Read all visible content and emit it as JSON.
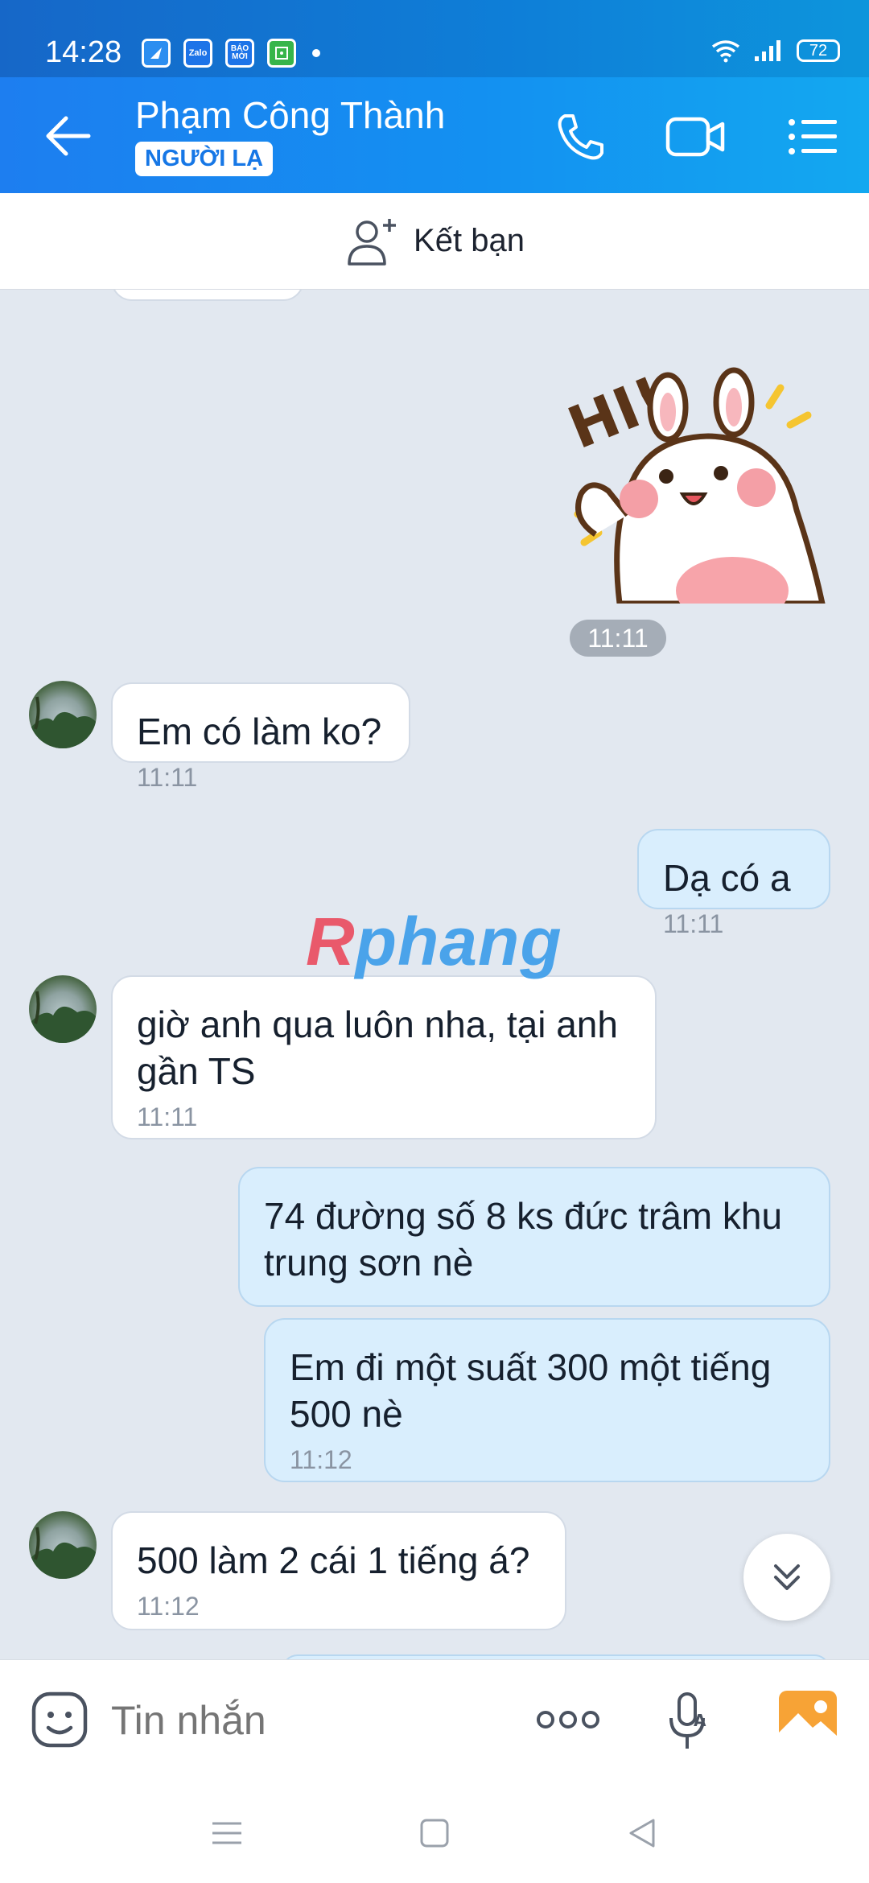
{
  "status": {
    "time": "14:28",
    "battery": "72",
    "app_icons": [
      "Zalo",
      "BÁO MỚI"
    ]
  },
  "header": {
    "contact_name": "Phạm Công Thành",
    "badge": "NGƯỜI LẠ"
  },
  "friend_bar": {
    "label": "Kết bạn"
  },
  "sticker_time": "11:11",
  "messages": [
    {
      "dir": "in",
      "text": "Em có làm ko?",
      "time": "11:11"
    },
    {
      "dir": "out",
      "text": "Dạ có a",
      "time": "11:11"
    },
    {
      "dir": "in",
      "text": "giờ anh qua luôn nha, tại anh gần TS",
      "time": "11:11"
    },
    {
      "dir": "out",
      "text": "74 đường số 8 ks đức trâm khu trung sơn nè",
      "time": ""
    },
    {
      "dir": "out",
      "text": "Em đi một suất 300 một tiếng 500 nè",
      "time": "11:12"
    },
    {
      "dir": "in",
      "text": "500 làm 2 cái 1 tiếng á?",
      "time": "11:12"
    }
  ],
  "watermark": {
    "part1": "R",
    "part2": "phang"
  },
  "composer": {
    "placeholder": "Tin nhắn"
  },
  "colors": {
    "header_start": "#1d7ef0",
    "header_end": "#13a8f0",
    "chat_bg": "#e2e8f0",
    "out_bubble": "#d9eefd",
    "in_bubble": "#ffffff"
  }
}
